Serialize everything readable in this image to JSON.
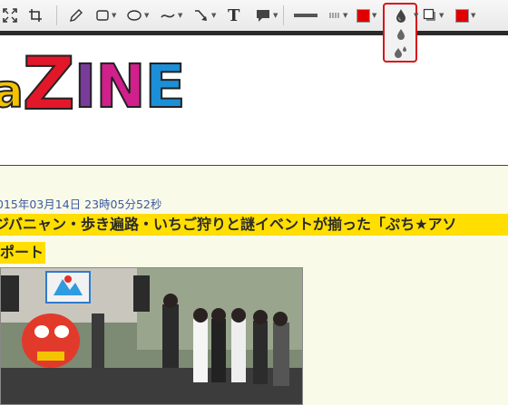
{
  "toolbar": {
    "tools": [
      {
        "name": "fullscreen-icon"
      },
      {
        "name": "crop-icon"
      },
      {
        "name": "pencil-icon"
      },
      {
        "name": "rectangle-icon"
      },
      {
        "name": "ellipse-icon"
      },
      {
        "name": "curve-icon"
      },
      {
        "name": "arrow-icon"
      },
      {
        "name": "text-icon"
      },
      {
        "name": "speech-bubble-icon"
      },
      {
        "name": "line-width-icon"
      },
      {
        "name": "line-style-icon"
      },
      {
        "name": "fill-color-swatch",
        "color": "#e00000"
      },
      {
        "name": "blur-drop-icon"
      },
      {
        "name": "shadow-icon"
      },
      {
        "name": "border-color-swatch",
        "color": "#e00000"
      }
    ],
    "text_tool_glyph": "T",
    "popup": {
      "highlight_color": "#d8141a",
      "options": [
        "single-drop-icon",
        "double-drop-icon"
      ]
    }
  },
  "site": {
    "logo_text": [
      "a",
      "Z",
      "I",
      "N",
      "E"
    ]
  },
  "article": {
    "date": "015年03月14日 23時05分52秒",
    "headline_line1": "ジバニャン・歩き遍路・いちご狩りと謎イベントが揃った「ぷち★アソ",
    "headline_line2": "ポート"
  },
  "colors": {
    "highlight": "#ffde00",
    "date_text": "#3b5aa3",
    "page_bg": "#fafae8"
  }
}
